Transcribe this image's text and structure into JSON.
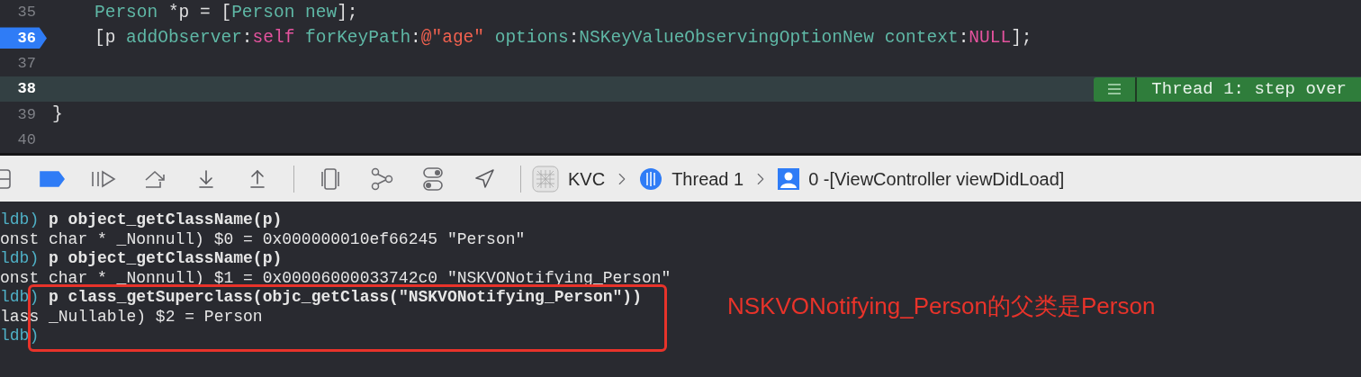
{
  "editor": {
    "lines": [
      {
        "number": "35",
        "indent": true,
        "breakpoint": false,
        "current": false,
        "tokens": [
          {
            "text": "Person",
            "kind": "type"
          },
          {
            "text": " *p = [",
            "kind": "plain"
          },
          {
            "text": "Person",
            "kind": "type"
          },
          {
            "text": " new",
            "kind": "method"
          },
          {
            "text": "];",
            "kind": "plain"
          }
        ]
      },
      {
        "number": "36",
        "indent": true,
        "breakpoint": true,
        "current": false,
        "tokens": [
          {
            "text": "[p ",
            "kind": "plain"
          },
          {
            "text": "addObserver",
            "kind": "method"
          },
          {
            "text": ":",
            "kind": "plain"
          },
          {
            "text": "self",
            "kind": "keyword"
          },
          {
            "text": " forKeyPath",
            "kind": "method"
          },
          {
            "text": ":",
            "kind": "plain"
          },
          {
            "text": "@\"age\"",
            "kind": "string"
          },
          {
            "text": " options",
            "kind": "method"
          },
          {
            "text": ":",
            "kind": "plain"
          },
          {
            "text": "NSKeyValueObservingOptionNew",
            "kind": "type"
          },
          {
            "text": " context",
            "kind": "method"
          },
          {
            "text": ":",
            "kind": "plain"
          },
          {
            "text": "NULL",
            "kind": "keyword"
          },
          {
            "text": "];",
            "kind": "plain"
          }
        ]
      },
      {
        "number": "37",
        "breakpoint": false,
        "current": false
      },
      {
        "number": "38",
        "breakpoint": false,
        "current": true
      },
      {
        "number": "39",
        "indent": false,
        "breakpoint": false,
        "current": false,
        "tokens": [
          {
            "text": "}",
            "kind": "plain"
          }
        ]
      },
      {
        "number": "40",
        "breakpoint": false,
        "current": false
      }
    ],
    "thread_badge": "Thread 1: step over"
  },
  "debug_bar": {
    "breakpoints_active": true,
    "breadcrumbs": [
      {
        "kind": "app",
        "label": "KVC"
      },
      {
        "kind": "thread",
        "label": "Thread 1"
      },
      {
        "kind": "frame",
        "label": "0 -[ViewController viewDidLoad]"
      }
    ]
  },
  "console": {
    "lines": [
      {
        "kind": "command",
        "prompt": "ldb)",
        "text": "p object_getClassName(p)",
        "boxed": false
      },
      {
        "kind": "output",
        "text": "onst char * _Nonnull) $0 = 0x000000010ef66245 \"Person\"",
        "boxed": false
      },
      {
        "kind": "command",
        "prompt": "ldb)",
        "text": "p object_getClassName(p)",
        "boxed": false
      },
      {
        "kind": "output",
        "text": "onst char * _Nonnull) $1 = 0x00006000033742c0 \"NSKVONotifying_Person\"",
        "boxed": false
      },
      {
        "kind": "command",
        "prompt": "ldb)",
        "text": "p class_getSuperclass(objc_getClass(\"NSKVONotifying_Person\"))",
        "boxed": true
      },
      {
        "kind": "output",
        "text": "lass _Nullable) $2 = Person",
        "boxed": true
      },
      {
        "kind": "command",
        "prompt": "ldb)",
        "boxed": true
      }
    ],
    "note": "NSKVONotifying_Person的父类是Person"
  }
}
